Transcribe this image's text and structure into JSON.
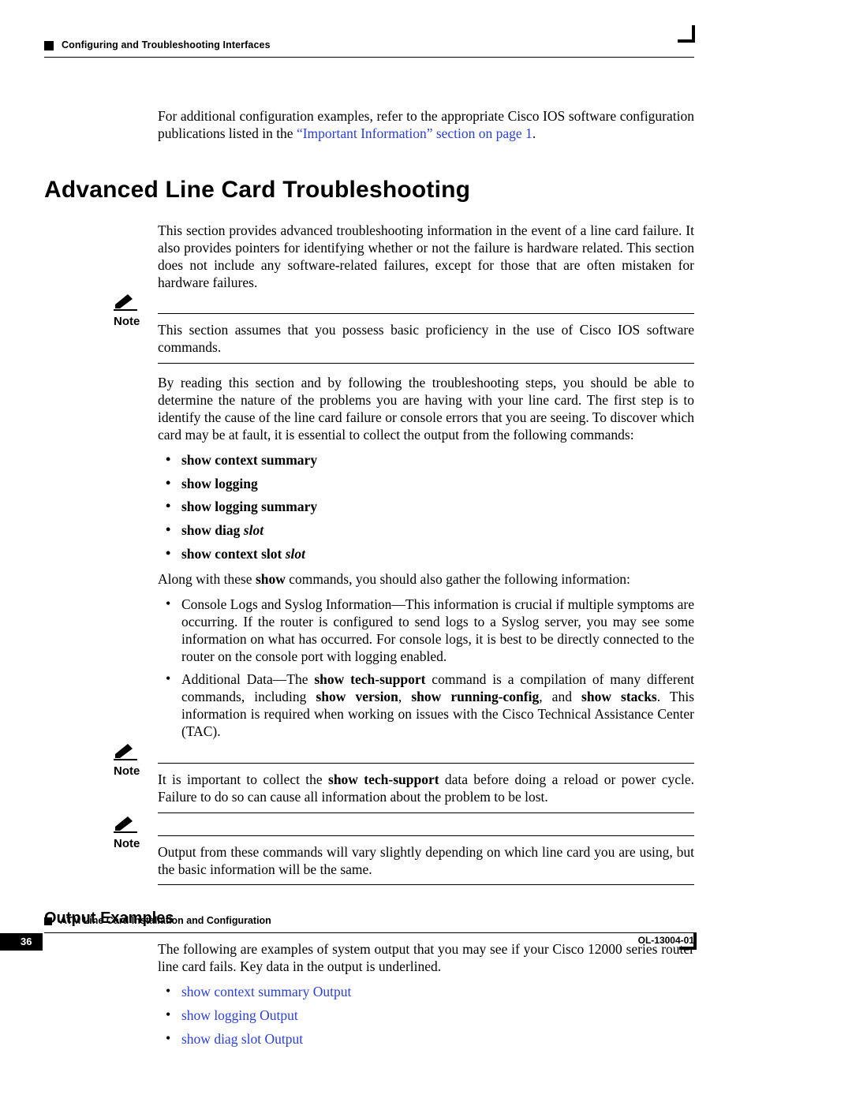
{
  "header": {
    "chapter_title": "Configuring and Troubleshooting Interfaces"
  },
  "intro": {
    "pre_link": "For additional configuration examples, refer to the appropriate Cisco IOS software configuration publications listed in the ",
    "link_text": "“Important Information” section on page 1",
    "post_link": "."
  },
  "section": {
    "title": "Advanced Line Card Troubleshooting",
    "p1": "This section provides advanced troubleshooting information in the event of a line card failure. It also provides pointers for identifying whether or not the failure is hardware related. This section does not include any software-related failures, except for those that are often mistaken for hardware failures."
  },
  "note1": {
    "label": "Note",
    "text": "This section assumes that you possess basic proficiency in the use of Cisco IOS software commands."
  },
  "p2": "By reading this section and by following the troubleshooting steps, you should be able to determine the nature of the problems you are having with your line card. The first step is to identify the cause of the line card failure or console errors that you are seeing. To discover which card may be at fault, it is essential to collect the output from the following commands:",
  "commands": [
    {
      "cmd": "show context summary",
      "slot": ""
    },
    {
      "cmd": "show logging",
      "slot": ""
    },
    {
      "cmd": "show logging summary",
      "slot": ""
    },
    {
      "cmd": "show diag",
      "slot": "slot"
    },
    {
      "cmd": "show context slot",
      "slot": "slot"
    }
  ],
  "p3_pre": "Along with these ",
  "p3_bold": "show",
  "p3_post": " commands, you should also gather the following information:",
  "info_bullets": {
    "b1": "Console Logs and Syslog Information—This information is crucial if multiple symptoms are occurring. If the router is configured to send logs to a Syslog server, you may see some information on what has occurred. For console logs, it is best to be directly connected to the router on the console port with logging enabled.",
    "b2_pre": "Additional Data—The ",
    "b2_cmd1": "show tech-support",
    "b2_mid1": " command is a compilation of many different commands, including ",
    "b2_cmd2": "show version",
    "b2_sep1": ", ",
    "b2_cmd3": "show running-config",
    "b2_sep2": ", and ",
    "b2_cmd4": "show stacks",
    "b2_post": ". This information is required when working on issues with the Cisco Technical Assistance Center (TAC)."
  },
  "note2": {
    "label": "Note",
    "pre": "It is important to collect the ",
    "bold": "show tech-support",
    "post": " data before doing a reload or power cycle. Failure to do so can cause all information about the problem to be lost."
  },
  "note3": {
    "label": "Note",
    "text": "Output from these commands will vary slightly depending on which line card you are using, but the basic information will be the same."
  },
  "subsection": {
    "title": "Output Examples"
  },
  "p4": "The following are examples of system output that you may see if your Cisco 12000 series router line card fails. Key data in the output is underlined.",
  "out_links": [
    "show context summary Output",
    "show logging Output",
    "show diag slot Output"
  ],
  "footer": {
    "doc_title": "ATM Line Card Installation and Configuration",
    "page_number": "36",
    "doc_id": "OL-13004-01"
  }
}
